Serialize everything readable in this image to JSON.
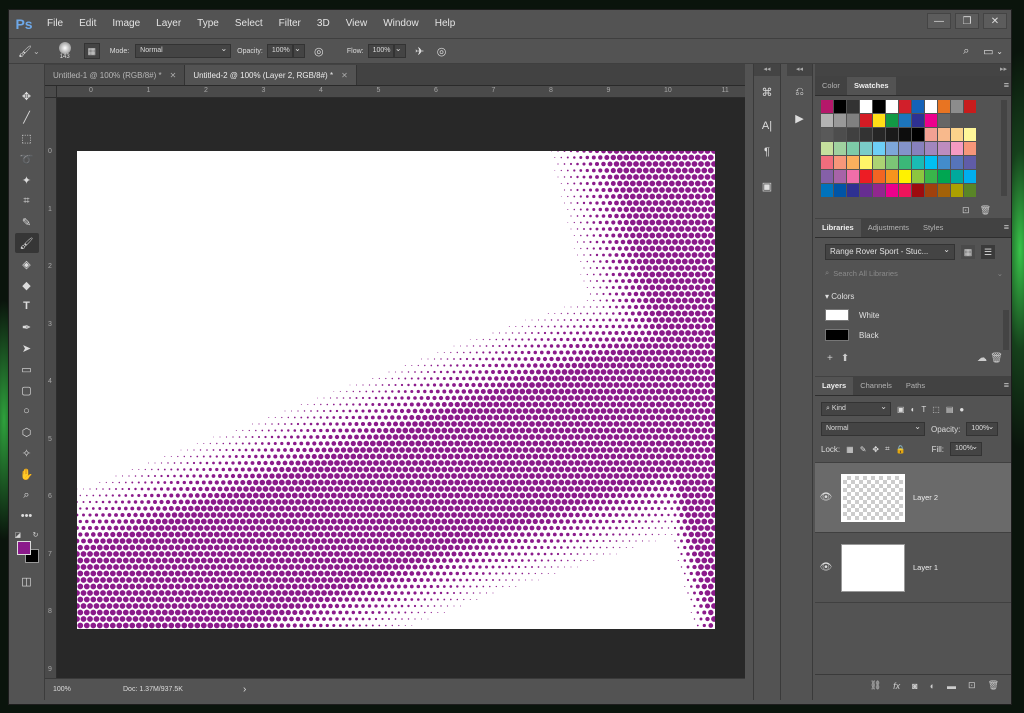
{
  "app": {
    "logo": "Ps",
    "menu": [
      "File",
      "Edit",
      "Image",
      "Layer",
      "Type",
      "Select",
      "Filter",
      "3D",
      "View",
      "Window",
      "Help"
    ],
    "window_controls": {
      "minimize": "—",
      "restore": "❐",
      "close": "✕"
    }
  },
  "options_bar": {
    "brush_size": "143",
    "mode_label": "Mode:",
    "mode_value": "Normal",
    "opacity_label": "Opacity:",
    "opacity_value": "100%",
    "flow_label": "Flow:",
    "flow_value": "100%"
  },
  "tabs": [
    {
      "label": "Untitled-1 @ 100% (RGB/8#) *",
      "active": false
    },
    {
      "label": "Untitled-2 @ 100% (Layer 2, RGB/8#) *",
      "active": true
    }
  ],
  "rulers": {
    "top": [
      "0",
      "1",
      "2",
      "3",
      "4",
      "5",
      "6",
      "7",
      "8",
      "9",
      "10",
      "11"
    ],
    "left": [
      "0",
      "1",
      "2",
      "3",
      "4",
      "5",
      "6",
      "7",
      "8",
      "9"
    ]
  },
  "status": {
    "zoom": "100%",
    "doc": "Doc: 1.37M/937.5K",
    "arrow": "›"
  },
  "canvas": {
    "halftone_color": "#8b1a8b"
  },
  "panels": {
    "color_tabs": [
      "Color",
      "Swatches"
    ],
    "swatch_colors": [
      [
        "#b5176a",
        "#000000",
        "#333333",
        "#ffffff",
        "#000000",
        "#ffffff",
        "#d11f2a",
        "#1462b8",
        "#ffffff",
        "#e87422",
        "#8c8c8c",
        "#c71c1c"
      ],
      [
        "#b3b3b3",
        "#999999",
        "#808080",
        "#d41b24",
        "#ffde17",
        "#129a45",
        "#1c75bc",
        "#2e3192",
        "#ec008c",
        "#666666"
      ],
      [
        "#595959",
        "#4d4d4d",
        "#404040",
        "#333333",
        "#262626",
        "#1a1a1a",
        "#0d0d0d",
        "#000000",
        "#f2a193",
        "#f8b98c",
        "#fcd38b",
        "#fff799"
      ],
      [
        "#c5df9d",
        "#9fd19f",
        "#7dcba8",
        "#7accc8",
        "#6dcff6",
        "#7da7d9",
        "#8393ca",
        "#8781bd",
        "#a186be",
        "#bd8cbf",
        "#f49ac2",
        "#f69679"
      ],
      [
        "#f26d7d",
        "#f7977a",
        "#fbaf5d",
        "#fff568",
        "#acd373",
        "#7cc576",
        "#3bb878",
        "#1abbb4",
        "#00bff3",
        "#438ccb",
        "#5674b9",
        "#605ca8"
      ],
      [
        "#8560a8",
        "#a763a8",
        "#f06ea9",
        "#ed1c24",
        "#f26522",
        "#f7941d",
        "#fff200",
        "#8dc63f",
        "#39b54a",
        "#00a651",
        "#00a99d",
        "#00aeef"
      ],
      [
        "#0072bc",
        "#0054a6",
        "#2e3192",
        "#662d91",
        "#92278f",
        "#ec008c",
        "#ed145b",
        "#9e0b0f",
        "#a0410d",
        "#a36209",
        "#aba000",
        "#598527"
      ]
    ],
    "library_tabs": [
      "Libraries",
      "Adjustments",
      "Styles"
    ],
    "library_name": "Range Rover Sport - Stuc...",
    "library_search": "Search All Libraries",
    "colors_group": "Colors",
    "library_colors": [
      {
        "name": "White",
        "hex": "#ffffff"
      },
      {
        "name": "Black",
        "hex": "#000000"
      }
    ],
    "layer_tabs": [
      "Layers",
      "Channels",
      "Paths"
    ],
    "kind_label": "Kind",
    "blend_mode": "Normal",
    "opacity_label": "Opacity:",
    "opacity_value": "100%",
    "lock_label": "Lock:",
    "fill_label": "Fill:",
    "fill_value": "100%",
    "layers": [
      {
        "name": "Layer 2",
        "active": true,
        "transparent": true
      },
      {
        "name": "Layer 1",
        "active": false,
        "transparent": false
      }
    ]
  }
}
